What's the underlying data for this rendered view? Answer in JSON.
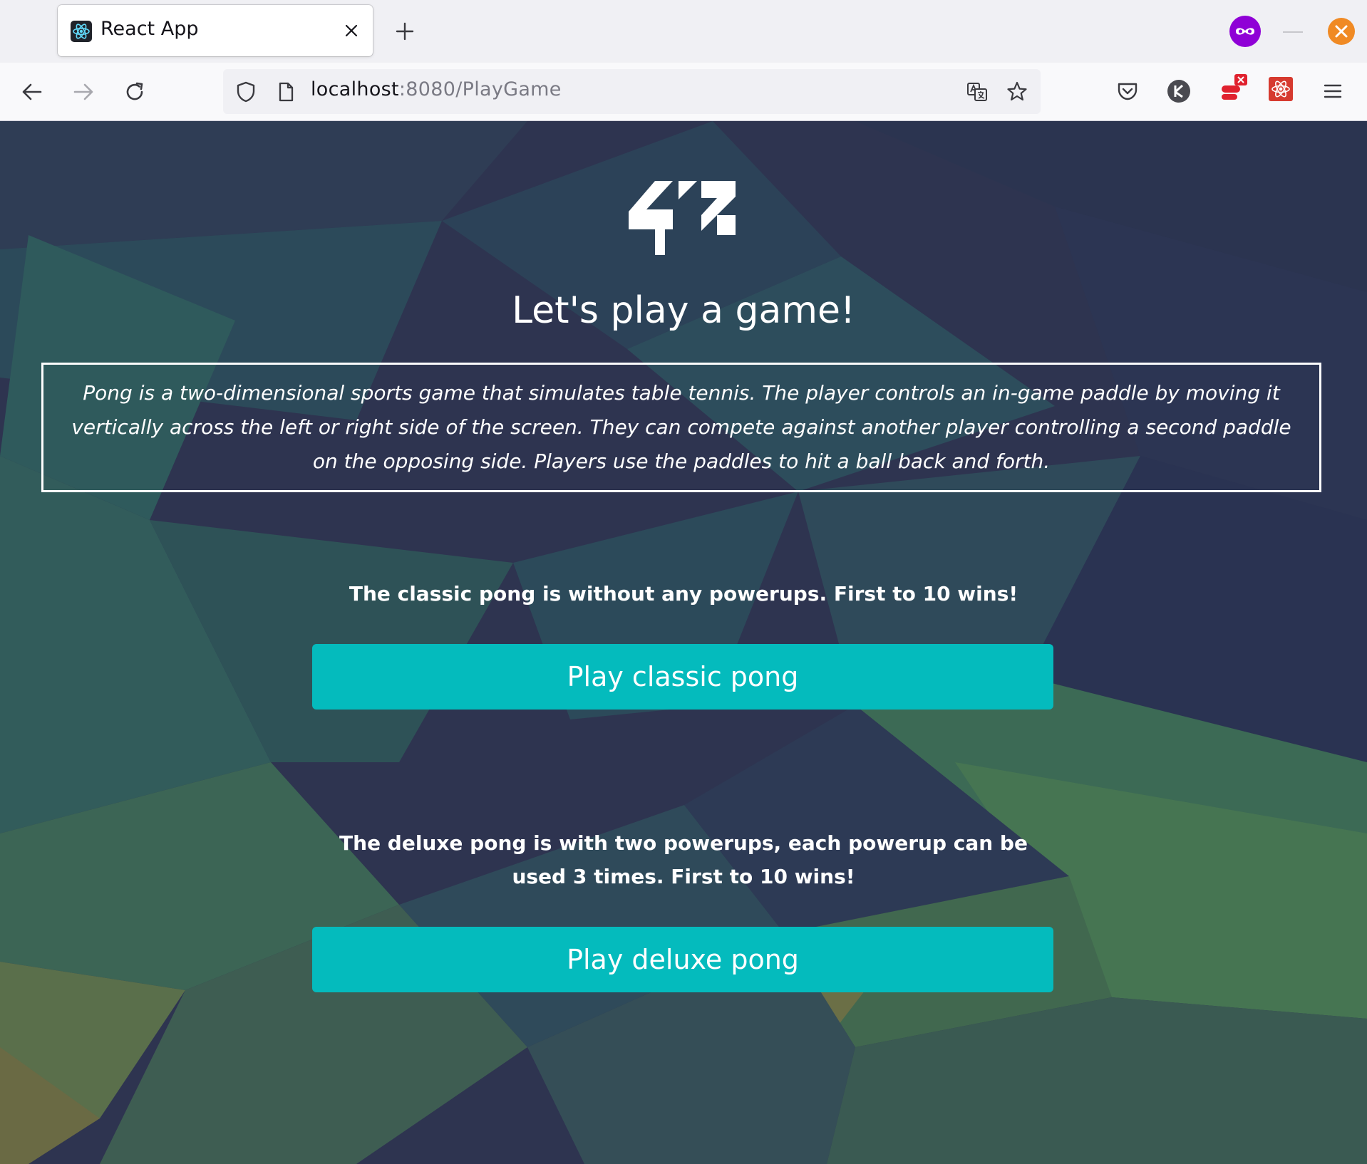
{
  "browser": {
    "tab_title": "React App",
    "url_host": "localhost",
    "url_rest": ":8080/PlayGame"
  },
  "page": {
    "title": "Let's play a game!",
    "description": "Pong is a two-dimensional sports game that simulates table tennis. The player controls an in-game paddle by moving it vertically across the left or right side of the screen. They can compete against another player controlling a second paddle on the opposing side. Players use the paddles to hit a ball back and forth.",
    "classic": {
      "text": "The classic pong is without any powerups. First to 10 wins!",
      "button_label": "Play classic pong"
    },
    "deluxe": {
      "text": "The deluxe pong is with two powerups, each powerup can be used 3 times. First to 10 wins!",
      "button_label": "Play deluxe pong"
    }
  },
  "colors": {
    "button": "#04bbbd",
    "background": "#2e3450"
  }
}
